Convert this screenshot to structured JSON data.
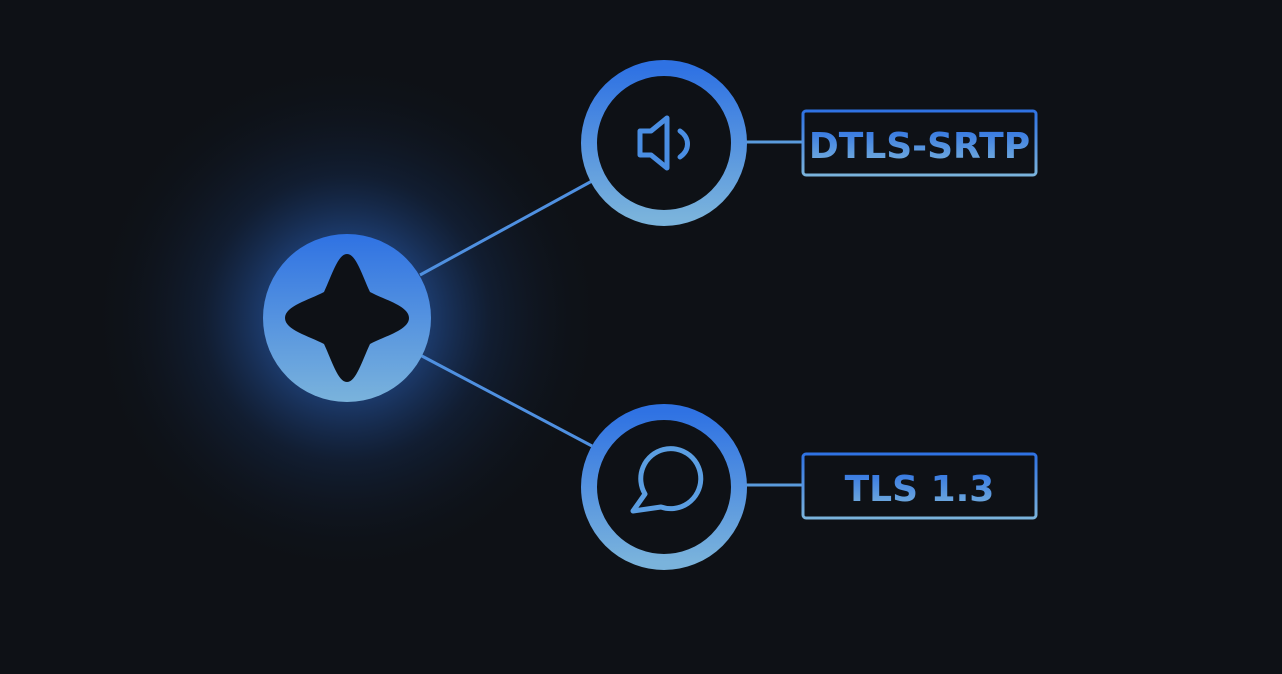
{
  "colors": {
    "background": "#0e1116",
    "accent_top": "#2f72e3",
    "accent_bottom": "#7ab3dc",
    "glow": "#2f6fd6",
    "inner_dark": "#0e1116"
  },
  "hub": {
    "icon": "sparkle-icon"
  },
  "channels": [
    {
      "icon": "speaker-icon",
      "label": "DTLS-SRTP"
    },
    {
      "icon": "chat-bubble-icon",
      "label": "TLS 1.3"
    }
  ]
}
